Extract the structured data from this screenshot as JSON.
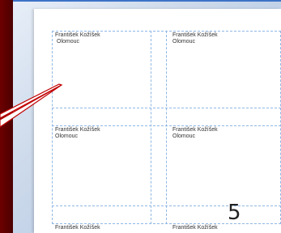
{
  "labels": [
    {
      "name": "František Kožíšek",
      "city": "Olomouc"
    },
    {
      "name": "František Kožíšek",
      "city": "Olomouc"
    },
    {
      "name": "František Kožíšek",
      "city": "Olomouc"
    },
    {
      "name": "František Kožíšek",
      "city": "Olomouc"
    },
    {
      "name": "František Kožíšek",
      "city": ""
    },
    {
      "name": "František Kožíšek",
      "city": ""
    }
  ],
  "callout": {
    "number": "5"
  },
  "colors": {
    "left_bar": "#5a0000",
    "guides": "#8fb7e6",
    "pointer": "#c00000"
  }
}
